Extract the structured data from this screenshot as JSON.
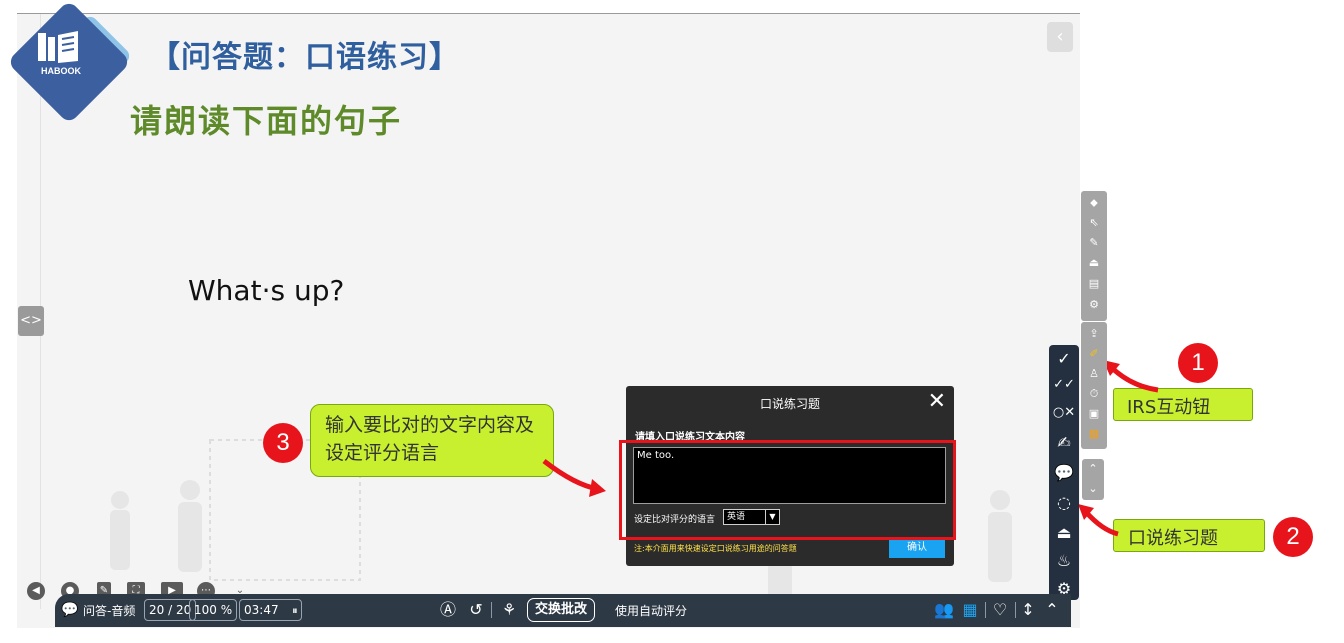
{
  "slide": {
    "logo_text": "HABOOK",
    "title": "【问答题：口语练习】",
    "subtitle": "请朗读下面的句子",
    "question": "What·s up?"
  },
  "dialog": {
    "title": "口说练习题",
    "prompt_label": "请填入口说练习文本内容",
    "text_value": "Me too.",
    "language_label": "设定比对评分的语言",
    "language_selected": "英语",
    "note": "注:本介面用来快速设定口说练习用途的问答题",
    "ok_label": "确认"
  },
  "callouts": {
    "step3_text": "输入要比对的文字内容及设定评分语言",
    "step3_number": "3",
    "step1_text": "IRS互动钮",
    "step1_number": "1",
    "step2_text": "口说练习题",
    "step2_number": "2"
  },
  "bottom_bar": {
    "mode_label": "问答-音频",
    "count": "20 / 20",
    "percent": "100 %",
    "timer": "03:47",
    "exchange_label": "交换批改",
    "auto_score_label": "使用自动评分"
  },
  "colors": {
    "accent_red": "#e8141c",
    "callout_green": "#c9f02f",
    "title_blue": "#2f5f9e",
    "subtitle_green": "#5e8a2a",
    "confirm_blue": "#1aa3f0",
    "toolbar_dark": "#24303f"
  }
}
